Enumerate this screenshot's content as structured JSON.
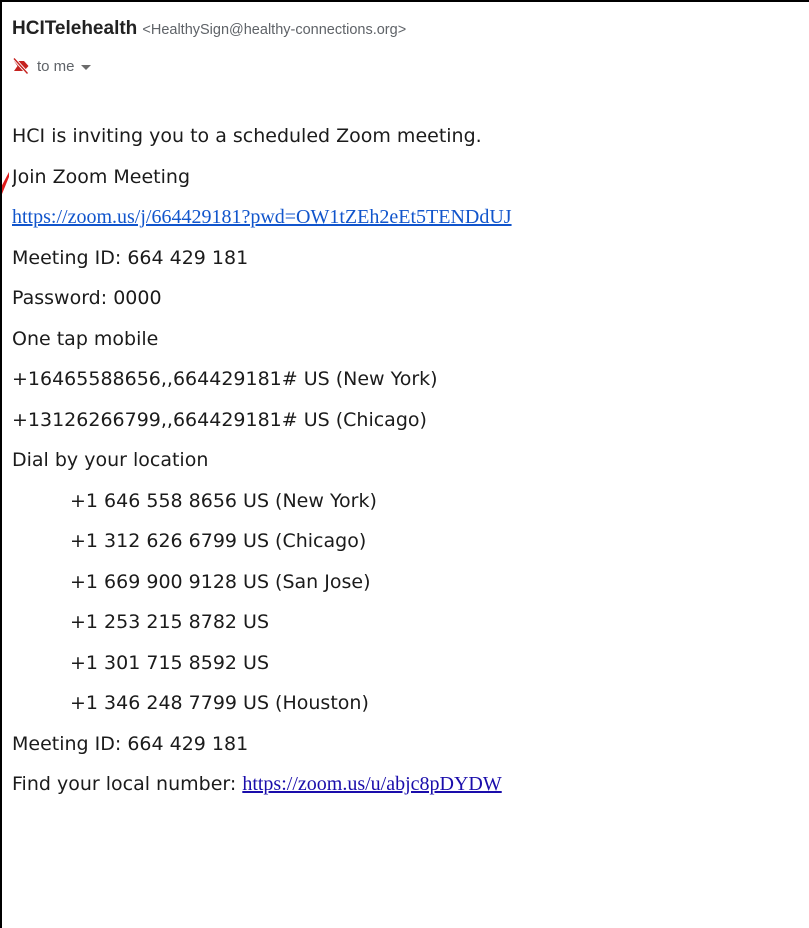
{
  "email": {
    "sender_name": "HCITelehealth",
    "sender_email": "<HealthySign@healthy-connections.org>",
    "to_label": "to me",
    "body": {
      "intro": "HCI is inviting you to a scheduled Zoom meeting.",
      "join_heading": "Join Zoom Meeting",
      "join_link": "https://zoom.us/j/664429181?pwd=OW1tZEh2eEt5TENDdUJ",
      "meeting_id_1": "Meeting ID: 664 429 181",
      "password": "Password: 0000",
      "one_tap_heading": "One tap mobile",
      "one_tap": [
        "+16465588656,,664429181# US (New York)",
        "+13126266799,,664429181# US (Chicago)"
      ],
      "dial_heading": "Dial by your location",
      "dial_numbers": [
        "+1 646 558 8656 US (New York)",
        "+1 312 626 6799 US (Chicago)",
        "+1 669 900 9128 US (San Jose)",
        "+1 253 215 8782 US",
        "+1 301 715 8592 US",
        "+1 346 248 7799 US (Houston)"
      ],
      "meeting_id_2": "Meeting ID: 664 429 181",
      "find_local_label": "Find your local number: ",
      "find_local_link": "https://zoom.us/u/abjc8pDYDW"
    }
  },
  "icons": {
    "importance": "not-important-icon",
    "expand": "chevron-down-icon"
  },
  "colors": {
    "link": "#1155cc",
    "importance_icon": "#c5221f",
    "annotation": "#e01b1b"
  }
}
